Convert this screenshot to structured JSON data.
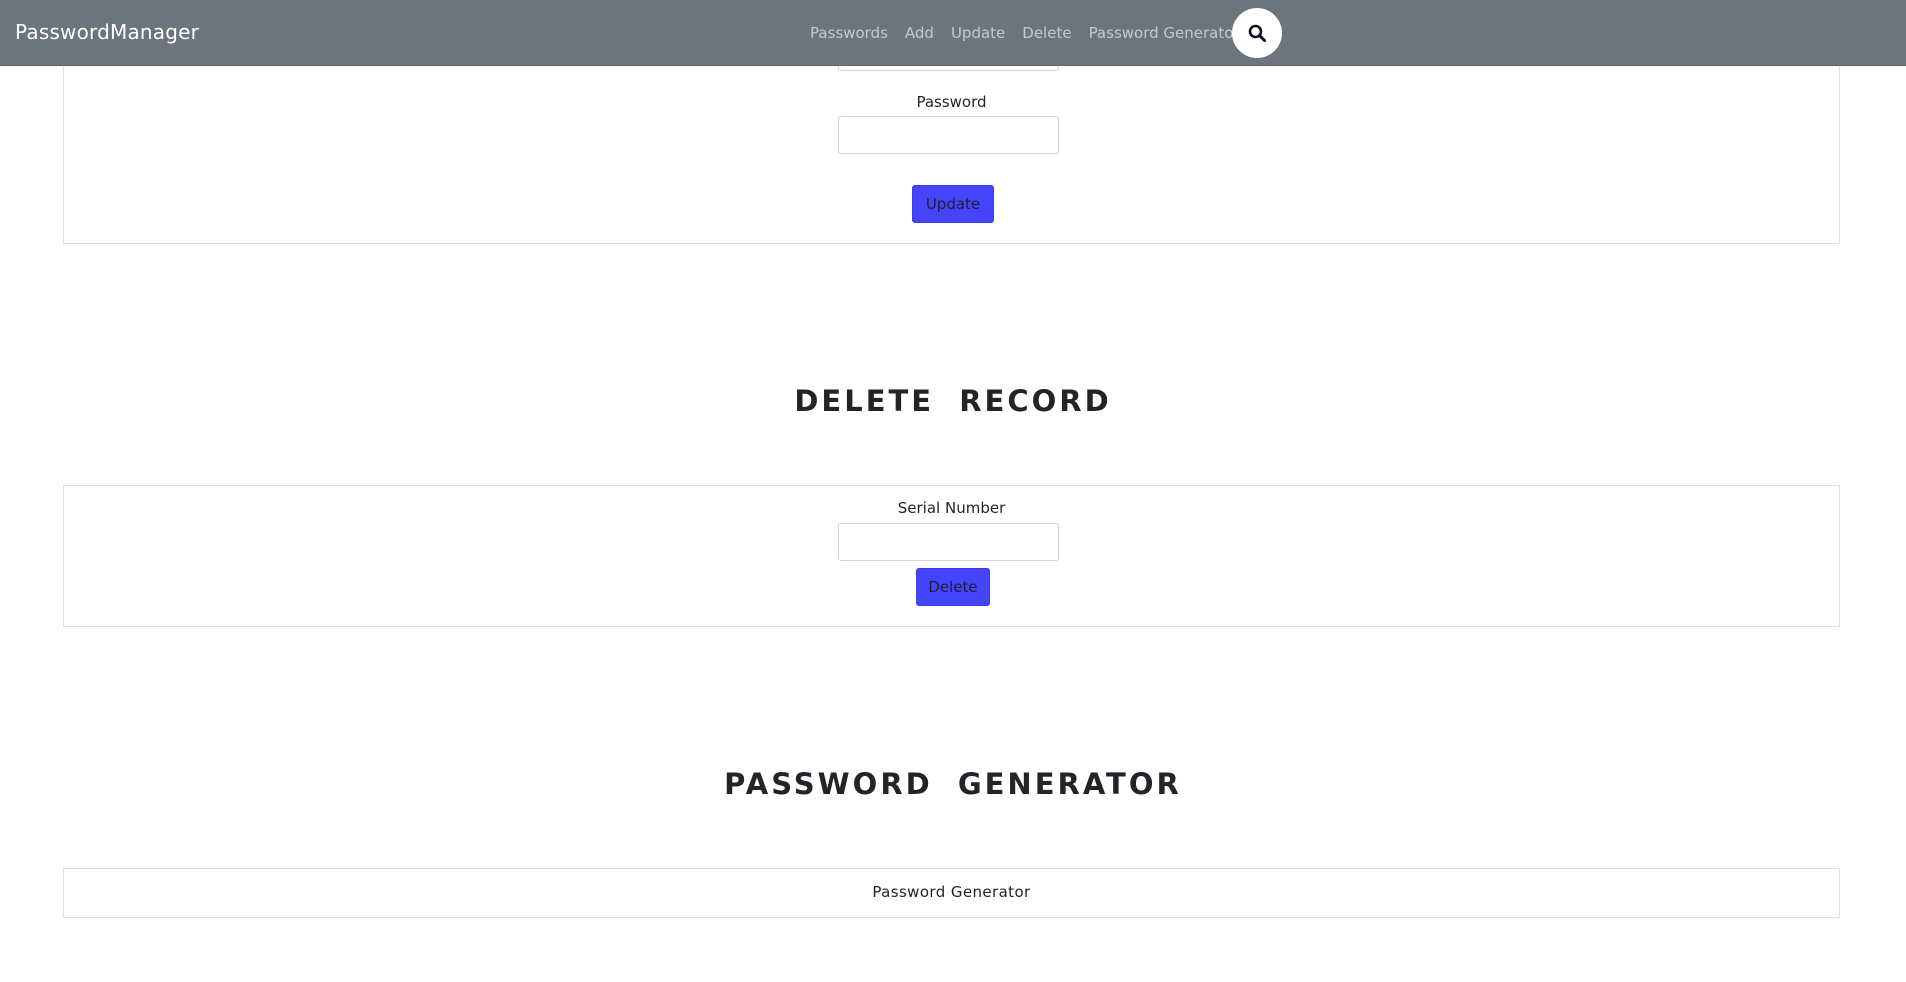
{
  "navbar": {
    "brand": "PasswordManager",
    "links": [
      "Passwords",
      "Add",
      "Update",
      "Delete",
      "Password Generator"
    ],
    "search_icon": "search-icon"
  },
  "update_section": {
    "password_label": "Password",
    "password_value": "",
    "update_button": "Update"
  },
  "delete_section": {
    "heading": "DELETE RECORD",
    "serial_label": "Serial Number",
    "serial_value": "",
    "delete_button": "Delete"
  },
  "generator_section": {
    "heading": "PASSWORD GENERATOR",
    "card_label": "Password Generator"
  },
  "colors": {
    "navbar_bg": "#6c757d",
    "button_bg": "#4444fb"
  }
}
